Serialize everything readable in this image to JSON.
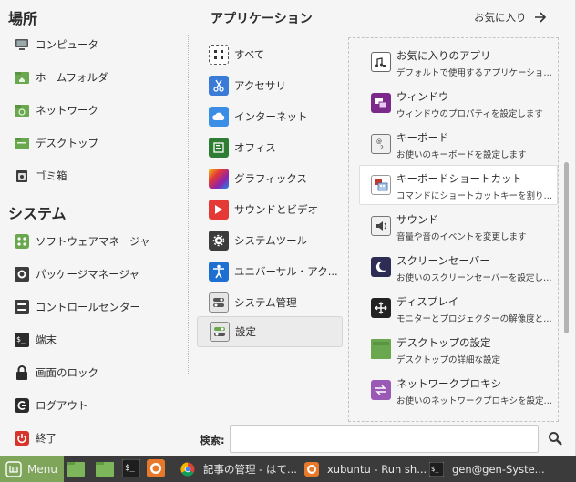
{
  "places": {
    "title": "場所",
    "items": [
      {
        "label": "コンピュータ",
        "icon": "computer-icon"
      },
      {
        "label": "ホームフォルダ",
        "icon": "home-folder-icon"
      },
      {
        "label": "ネットワーク",
        "icon": "network-folder-icon"
      },
      {
        "label": "デスクトップ",
        "icon": "desktop-folder-icon"
      },
      {
        "label": "ゴミ箱",
        "icon": "trash-icon"
      }
    ]
  },
  "system": {
    "title": "システム",
    "items": [
      {
        "label": "ソフトウェアマネージャ",
        "icon": "software-manager-icon"
      },
      {
        "label": "パッケージマネージャ",
        "icon": "package-manager-icon"
      },
      {
        "label": "コントロールセンター",
        "icon": "control-center-icon"
      },
      {
        "label": "端末",
        "icon": "terminal-icon"
      },
      {
        "label": "画面のロック",
        "icon": "lock-icon"
      },
      {
        "label": "ログアウト",
        "icon": "logout-icon"
      },
      {
        "label": "終了",
        "icon": "power-icon"
      }
    ]
  },
  "applications": {
    "title": "アプリケーション",
    "favorites_label": "お気に入り",
    "categories": [
      {
        "label": "すべて",
        "icon": "all-apps-icon",
        "color": "#ffffff"
      },
      {
        "label": "アクセサリ",
        "icon": "accessories-icon",
        "color": "#3b7bd8"
      },
      {
        "label": "インターネット",
        "icon": "internet-icon",
        "color": "#3a8ee6"
      },
      {
        "label": "オフィス",
        "icon": "office-icon",
        "color": "#2f7d32"
      },
      {
        "label": "グラフィックス",
        "icon": "graphics-icon",
        "color": "#d63ca0"
      },
      {
        "label": "サウンドとビデオ",
        "icon": "sound-video-icon",
        "color": "#e53935"
      },
      {
        "label": "システムツール",
        "icon": "system-tools-icon",
        "color": "#3c3c3c"
      },
      {
        "label": "ユニバーサル・アク...",
        "icon": "universal-access-icon",
        "color": "#1f6fd1"
      },
      {
        "label": "システム管理",
        "icon": "administration-icon",
        "color": "#5a5a5a"
      },
      {
        "label": "設定",
        "icon": "settings-icon",
        "color": "#5a5a5a"
      }
    ],
    "active_category": "設定",
    "apps": [
      {
        "name": "お気に入りのアプリ",
        "desc": "デフォルトで使用するアプリケーションを...",
        "icon": "favorite-apps-icon",
        "color": "#5c5c5c"
      },
      {
        "name": "ウィンドウ",
        "desc": "ウィンドウのプロパティを設定します",
        "icon": "windows-icon",
        "color": "#7b2a8c"
      },
      {
        "name": "キーボード",
        "desc": "お使いのキーボードを設定します",
        "icon": "keyboard-icon",
        "color": "#8a8a8a"
      },
      {
        "name": "キーボードショートカット",
        "desc": "コマンドにショートカットキーを割り当て...",
        "icon": "keyboard-shortcuts-icon",
        "color": "#c0392b"
      },
      {
        "name": "サウンド",
        "desc": "音量や音のイベントを変更します",
        "icon": "sound-icon",
        "color": "#8a8a8a"
      },
      {
        "name": "スクリーンセーバー",
        "desc": "お使いのスクリーンセーバーを設定します",
        "icon": "screensaver-icon",
        "color": "#2c2c54"
      },
      {
        "name": "ディスプレイ",
        "desc": "モニターとプロジェクターの解像度と位...",
        "icon": "display-icon",
        "color": "#222222"
      },
      {
        "name": "デスクトップの設定",
        "desc": "デスクトップの詳細な設定",
        "icon": "desktop-settings-icon",
        "color": "#6aa84f"
      },
      {
        "name": "ネットワークプロキシ",
        "desc": "お使いのネットワークプロキシを設定します",
        "icon": "network-proxy-icon",
        "color": "#9b59b6"
      }
    ],
    "highlighted_app": "キーボードショートカット"
  },
  "search": {
    "label": "検索:",
    "value": ""
  },
  "taskbar": {
    "menu_label": "Menu",
    "tasks": [
      {
        "label": "記事の管理 - はて...",
        "icon": "chrome-icon"
      },
      {
        "label": "xubuntu - Run sh...",
        "icon": "firefox-icon"
      },
      {
        "label": "gen@gen-Syste...",
        "icon": "terminal-icon"
      }
    ]
  },
  "colors": {
    "menu_bg": "#f5f5f5",
    "taskbar_bg": "#3b3b3b",
    "menu_button": "#7ea55a",
    "folder_green": "#6aa84f"
  }
}
